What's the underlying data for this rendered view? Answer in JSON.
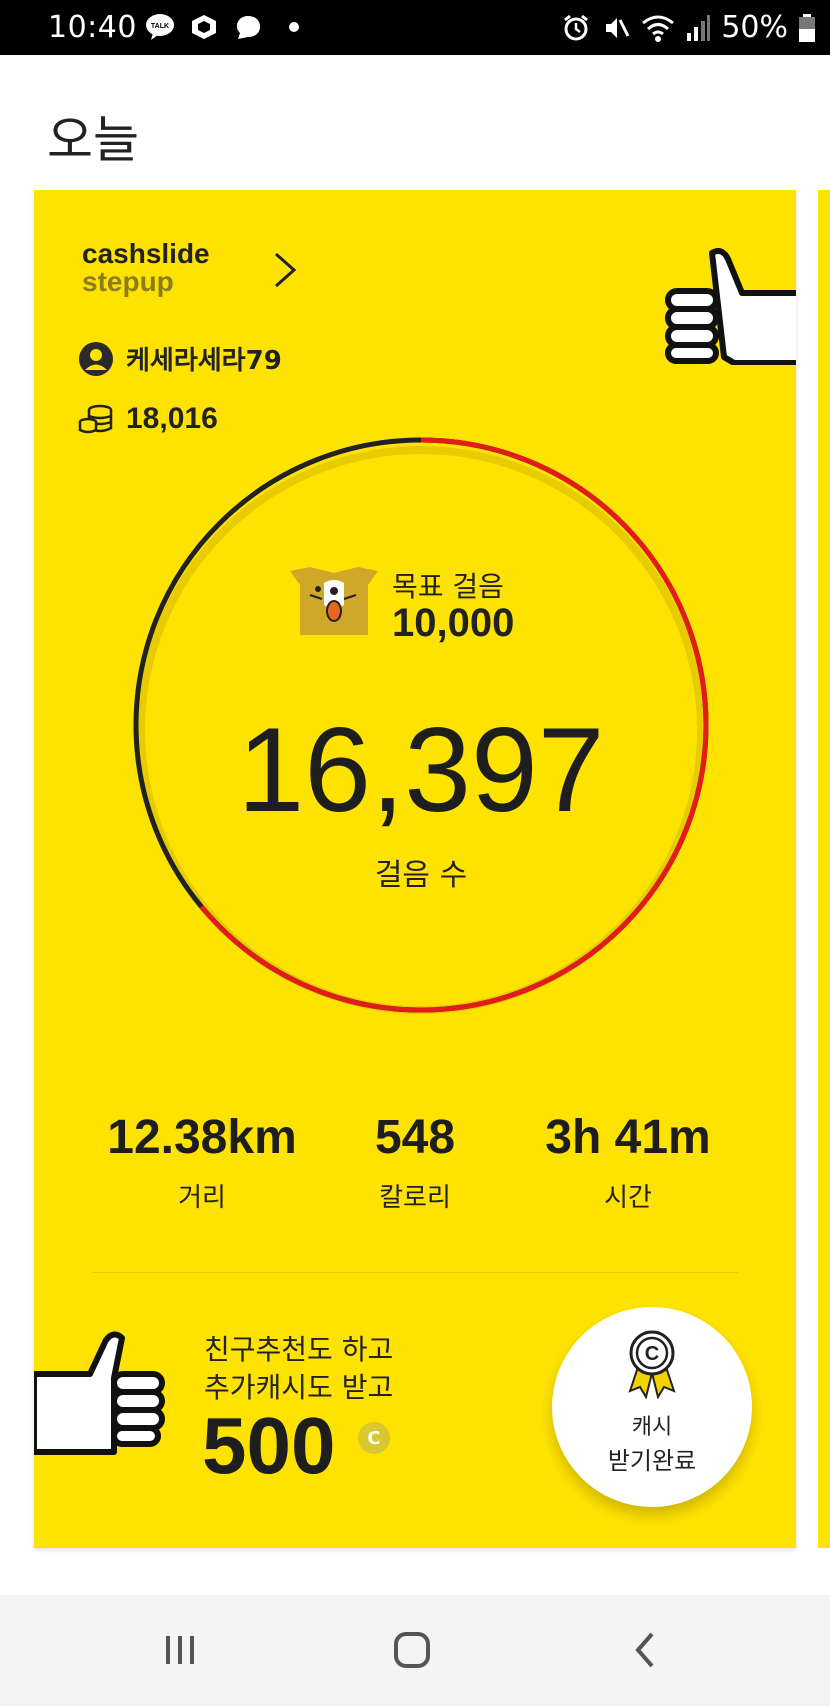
{
  "status_bar": {
    "time": "10:40",
    "talk_badge": "TALK",
    "battery": "50%"
  },
  "page": {
    "title": "오늘"
  },
  "card": {
    "brand_line1": "cashslide",
    "brand_line2": "stepup",
    "username": "케세라세라79",
    "coins": "18,016",
    "goal_label": "목표 걸음",
    "goal_value": "10,000",
    "steps": "16,397",
    "steps_label": "걸음 수",
    "progress_ratio": 0.64,
    "stats": [
      {
        "value": "12.38km",
        "label": "거리"
      },
      {
        "value": "548",
        "label": "칼로리"
      },
      {
        "value": "3h 41m",
        "label": "시간"
      }
    ],
    "promo_line1": "친구추천도 하고",
    "promo_line2": "추가캐시도 받고",
    "promo_amount": "500",
    "promo_unit": "C",
    "reward_line1": "캐시",
    "reward_line2": "받기완료"
  },
  "colors": {
    "card_bg": "#ffe300",
    "ring_done": "#e31b1b",
    "ring_track": "#222222"
  }
}
